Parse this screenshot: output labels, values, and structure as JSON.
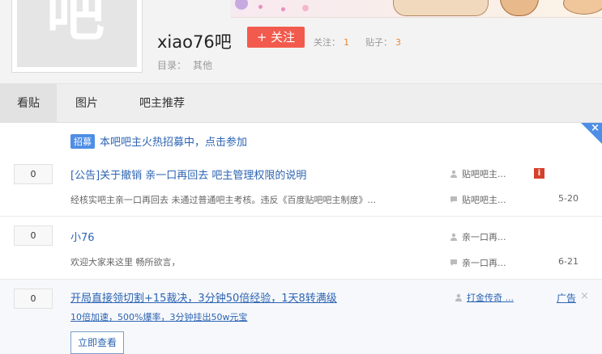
{
  "header": {
    "avatar_glyph": "吧",
    "forum_name": "xiao76吧",
    "follow_label": "+ 关注",
    "follow_stat": {
      "label": "关注：",
      "value": "1"
    },
    "post_stat": {
      "label": "贴子：",
      "value": "3"
    },
    "catalog": {
      "label": "目录：",
      "value": "其他"
    }
  },
  "tabs": [
    "看贴",
    "图片",
    "吧主推荐"
  ],
  "notice": {
    "badge": "招募",
    "text": "本吧吧主火热招募中，点击参加",
    "close": "×"
  },
  "posts": [
    {
      "replies": "0",
      "title": "[公告]关于撤销 亲一口再回去 吧主管理权限的说明",
      "abstract": "经核实吧主亲一口再回去 未通过普通吧主考核。违反《百度贴吧吧主制度》...",
      "author": "贴吧吧主...",
      "last_reply": "贴吧吧主...",
      "date": "5-20",
      "flag": "i"
    },
    {
      "replies": "0",
      "title": "小76",
      "abstract": "欢迎大家来这里 畅所欲言，",
      "author": "亲一口再...",
      "last_reply": "亲一口再...",
      "date": "6-21"
    }
  ],
  "ad": {
    "replies": "0",
    "title": "开局直接领切割+15裁决，3分钟50倍经验，1天8转满级",
    "subtitle": "10倍加速，500%爆率，3分钟挂出50w元宝",
    "author": "打金传奇 ...",
    "label": "广告",
    "close": "×",
    "button": "立即查看"
  },
  "colors": {
    "accent": "#4e8ee6",
    "follow": "#f25a4d",
    "link": "#2d64b3",
    "stat": "#e68838"
  }
}
